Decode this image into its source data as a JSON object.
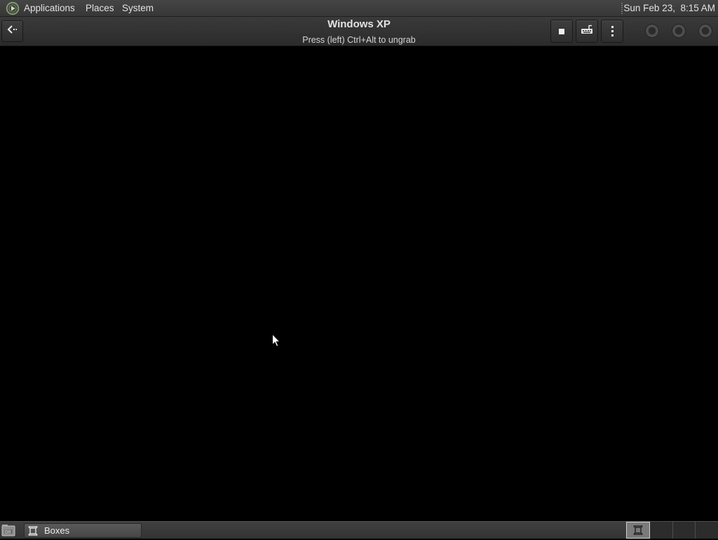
{
  "top_panel": {
    "menu_icon": "applications-menu-icon",
    "menus": [
      {
        "label": "Applications"
      },
      {
        "label": "Places"
      },
      {
        "label": "System"
      }
    ],
    "clock": "Sun Feb 23,  8:15 AM"
  },
  "window": {
    "title": "Windows XP",
    "subtitle": "Press (left) Ctrl+Alt to ungrab",
    "back_button_icon": "back-arrow-icon",
    "toolbar_icons": [
      "stop-icon",
      "keyboard-icon",
      "menu-dots-icon"
    ],
    "window_controls": [
      "minimize-button",
      "maximize-button",
      "close-button"
    ]
  },
  "vm_display": {
    "cursor_icon": "mouse-pointer-icon",
    "background": "#000000"
  },
  "bottom_panel": {
    "show_desktop_icon": "show-desktop-icon",
    "tasks": [
      {
        "label": "Boxes",
        "icon": "boxes-app-icon",
        "active": true
      }
    ],
    "workspace_switcher": {
      "workspaces": [
        {
          "active": true,
          "has_window": true
        },
        {
          "active": false,
          "has_window": false
        },
        {
          "active": false,
          "has_window": false
        },
        {
          "active": false,
          "has_window": false
        }
      ]
    }
  },
  "colors": {
    "panel_bg": "#3a3a3a",
    "headerbar_bg": "#2f2f2f",
    "text": "#e0e0e0",
    "display_bg": "#000000"
  }
}
